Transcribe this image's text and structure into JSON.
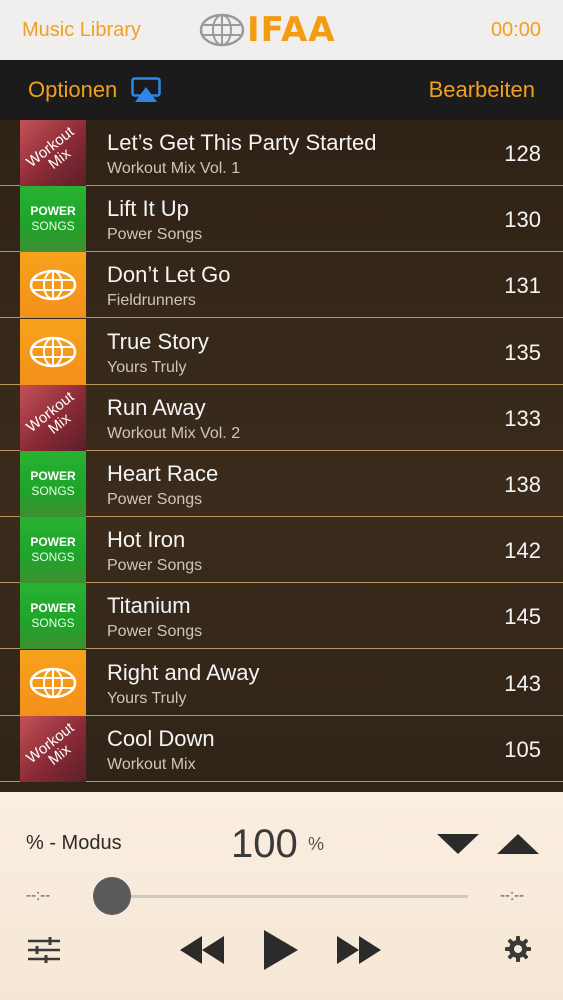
{
  "topbar": {
    "app_title": "Music Library",
    "brand": "IFAA",
    "clock": "00:00"
  },
  "navbar": {
    "options_label": "Optionen",
    "edit_label": "Bearbeiten"
  },
  "tracks": [
    {
      "title": "Let’s Get This Party Started",
      "album": "Workout Mix Vol. 1",
      "bpm": "128",
      "art": "workout"
    },
    {
      "title": "Lift It Up",
      "album": "Power Songs",
      "bpm": "130",
      "art": "power"
    },
    {
      "title": "Don’t Let Go",
      "album": "Fieldrunners",
      "bpm": "131",
      "art": "ifaa"
    },
    {
      "title": "True Story",
      "album": "Yours Truly",
      "bpm": "135",
      "art": "ifaa"
    },
    {
      "title": "Run Away",
      "album": "Workout Mix Vol. 2",
      "bpm": "133",
      "art": "workout"
    },
    {
      "title": "Heart Race",
      "album": "Power Songs",
      "bpm": "138",
      "art": "power"
    },
    {
      "title": "Hot Iron",
      "album": "Power Songs",
      "bpm": "142",
      "art": "power"
    },
    {
      "title": "Titanium",
      "album": "Power Songs",
      "bpm": "145",
      "art": "power"
    },
    {
      "title": "Right and Away",
      "album": "Yours Truly",
      "bpm": "143",
      "art": "ifaa"
    },
    {
      "title": "Cool Down",
      "album": "Workout Mix",
      "bpm": "105",
      "art": "workout"
    }
  ],
  "art_labels": {
    "workout_line1": "Workout",
    "workout_line2": "Mix",
    "power_line1": "POWER",
    "power_line2": "SONGS"
  },
  "player": {
    "mode_label": "% - Modus",
    "percent_value": "100",
    "percent_unit": "%",
    "elapsed": "--:--",
    "remaining": "--:--",
    "progress": 0
  },
  "colors": {
    "accent": "#f0a021",
    "player_bg": "#faeee0"
  }
}
